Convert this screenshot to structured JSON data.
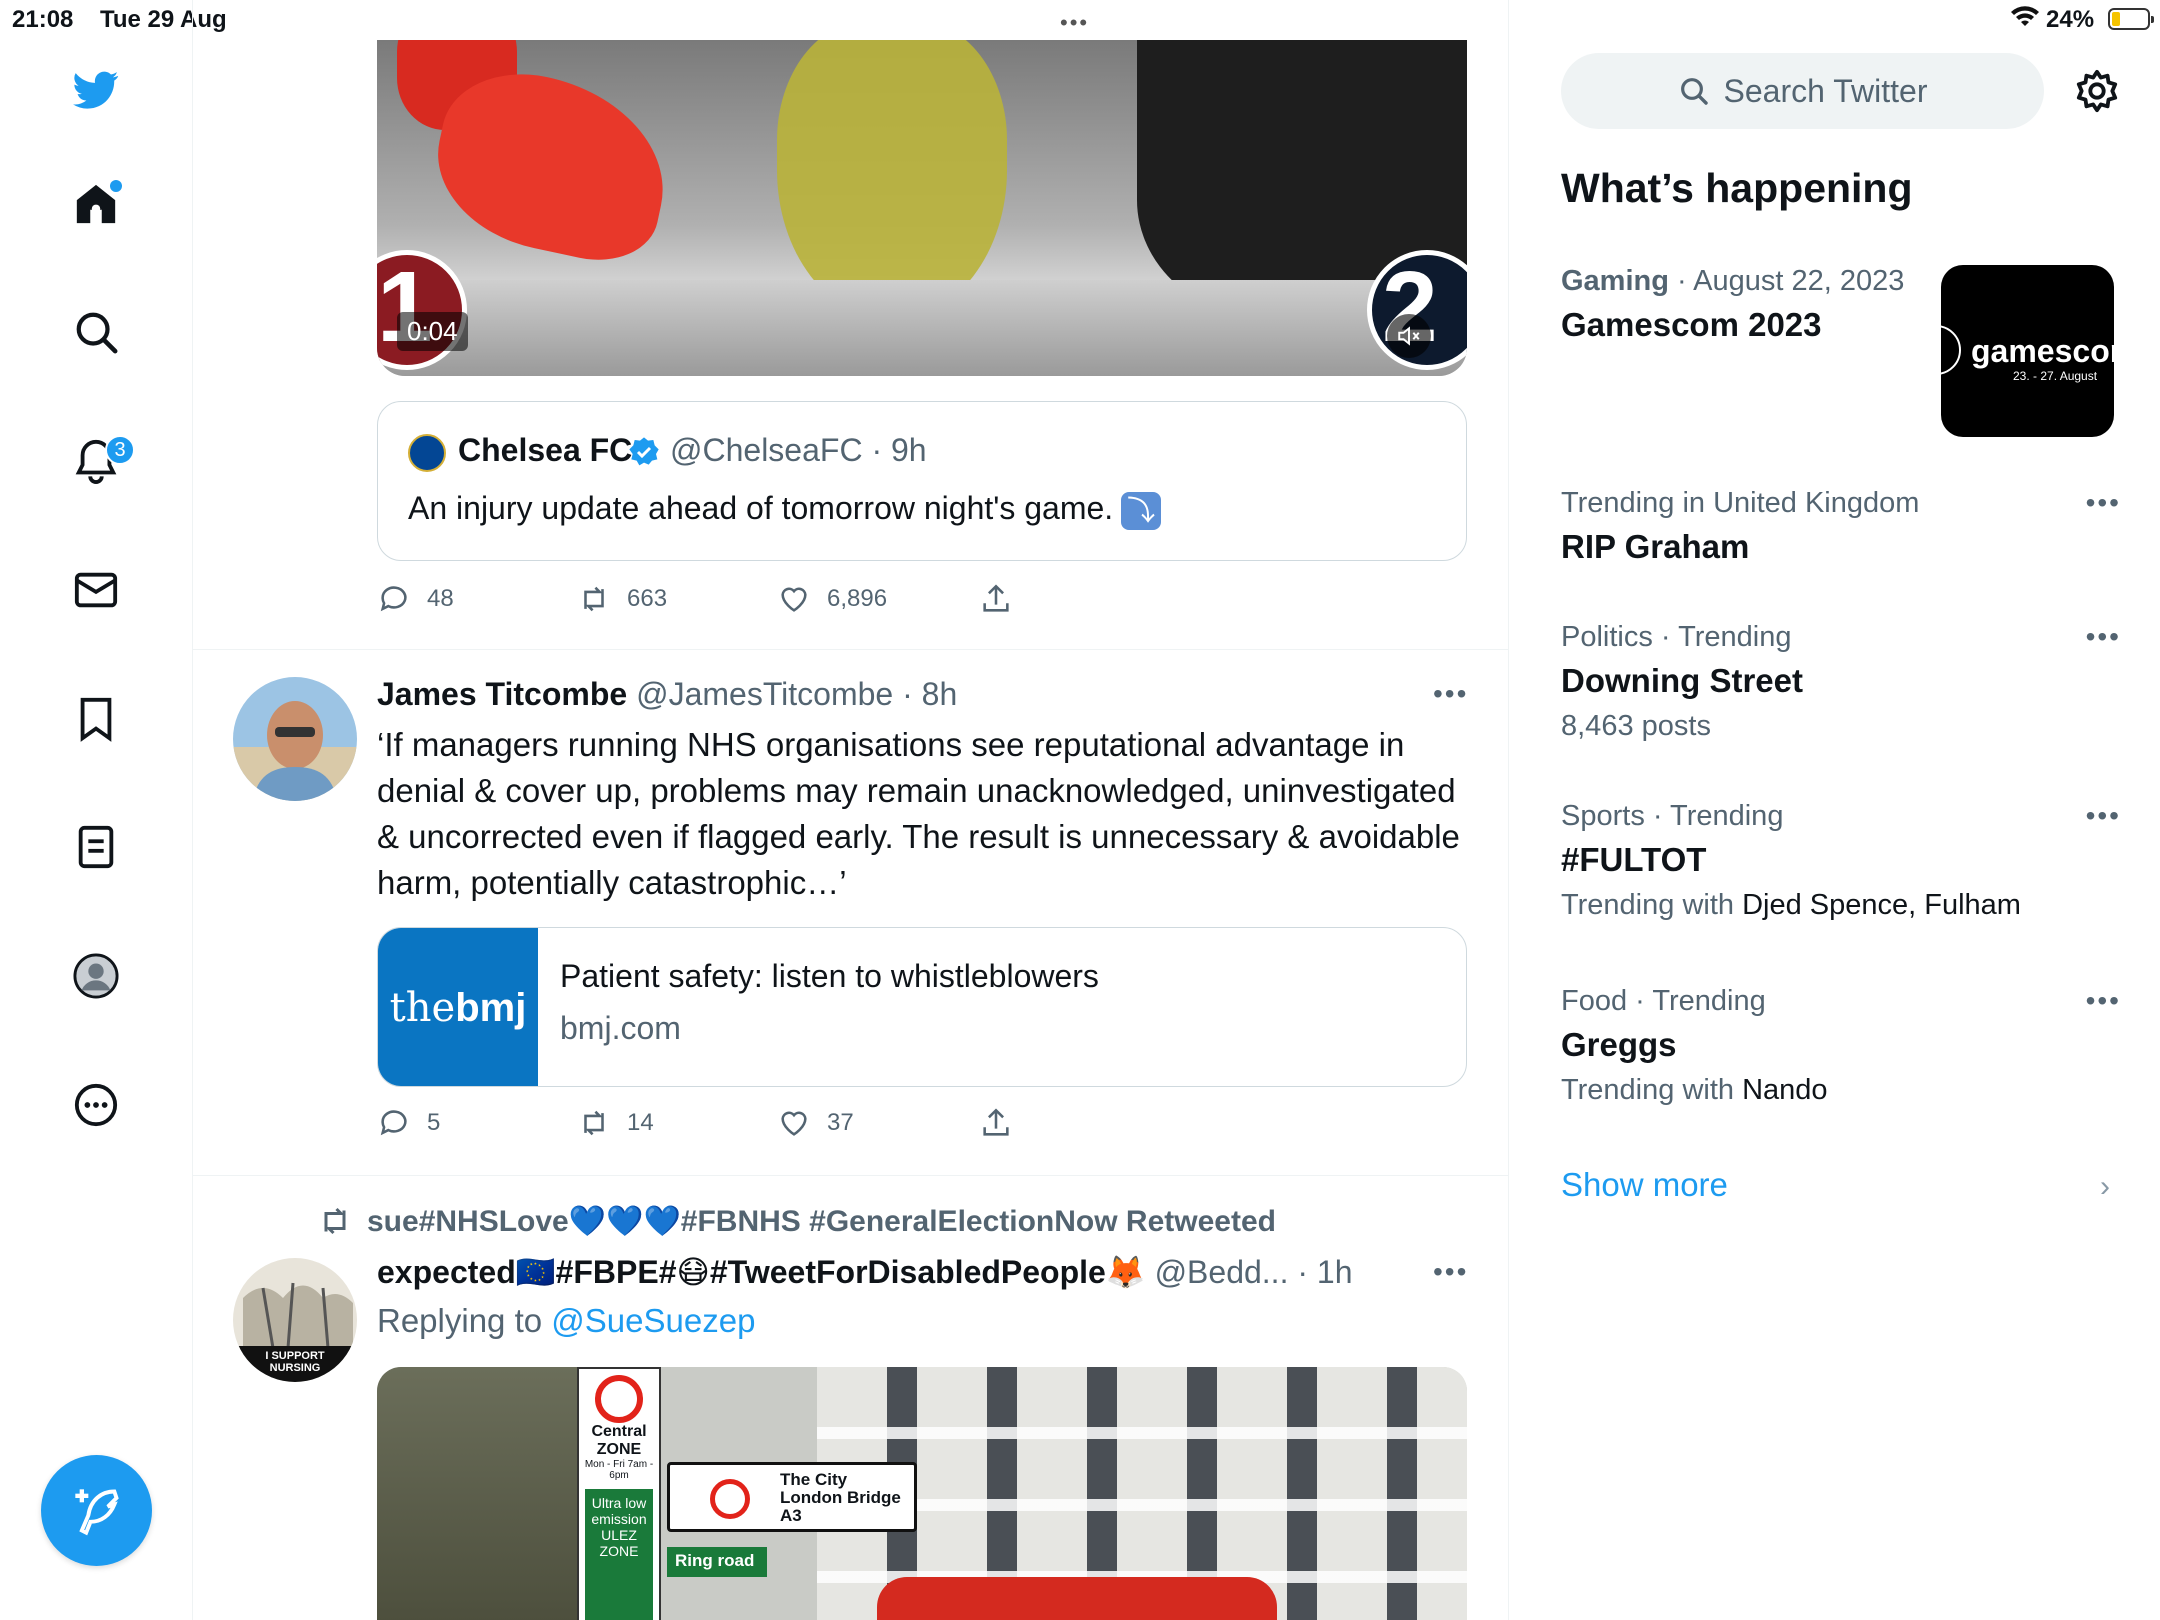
{
  "status_bar": {
    "time": "21:08",
    "date": "Tue 29 Aug",
    "battery": "24%",
    "battery_level": 0.24
  },
  "nav": {
    "items": [
      {
        "name": "home",
        "has_dot": true
      },
      {
        "name": "explore"
      },
      {
        "name": "notifications",
        "badge": "3"
      },
      {
        "name": "messages"
      },
      {
        "name": "bookmarks"
      },
      {
        "name": "lists"
      },
      {
        "name": "profile"
      },
      {
        "name": "more"
      }
    ],
    "accent": "#1d9bf0"
  },
  "tweet1": {
    "video_duration": "0:04",
    "score_left": "1",
    "score_right": "2",
    "quote": {
      "name": "Chelsea FC",
      "handle_time": "@ChelseaFC · 9h",
      "text": "An injury update ahead of tomorrow night's game.",
      "emoji": "⤵"
    },
    "actions": {
      "replies": "48",
      "retweets": "663",
      "likes": "6,896"
    }
  },
  "tweet2": {
    "name": "James Titcombe",
    "handle_time": "@JamesTitcombe · 8h",
    "text": "‘If managers running NHS organisations see reputational advantage in denial & cover up, problems may remain unacknowledged, uninvestigated & uncorrected even if flagged early. The result is unnecessary & avoidable harm, potentially catastrophic…’",
    "card": {
      "thumb_light": "the",
      "thumb_bold": "bmj",
      "title": "Patient safety: listen to whistleblowers",
      "domain": "bmj.com"
    },
    "actions": {
      "replies": "5",
      "retweets": "14",
      "likes": "37"
    }
  },
  "tweet3": {
    "retweeted_by": "sue#NHSLove💙💙💙#FBNHS #GeneralElectionNow Retweeted",
    "name": "expected🇪🇺#FBPE#😷#TweetForDisabledPeople🦊",
    "handle_time": "@Bedd... · 1h",
    "replying_prefix": "Replying to",
    "replying_handle": "@SueSuezep",
    "avatar_text": "I SUPPORT NURSING",
    "signs": {
      "central": "Central ZONE",
      "hours": "Mon - Fri 7am - 6pm",
      "ulez": "Ultra low emission ULEZ ZONE",
      "direction": "The City London Bridge A3",
      "ring": "Ring road"
    }
  },
  "sidebar": {
    "search_placeholder": "Search Twitter",
    "section_title": "What’s happening",
    "trends": [
      {
        "category": "Gaming",
        "context": " · August 22, 2023",
        "title": "Gamescom 2023",
        "sub_prefix": "",
        "sub_value": "",
        "thumb_text": "gamescom",
        "thumb_dates": "23. - 27. August"
      },
      {
        "category": "Trending in United Kingdom",
        "context": "",
        "title": "RIP Graham",
        "sub_prefix": "",
        "sub_value": ""
      },
      {
        "category": "Politics · Trending",
        "context": "",
        "title": "Downing Street",
        "sub_prefix": "8,463 posts",
        "sub_value": ""
      },
      {
        "category": "Sports · Trending",
        "context": "",
        "title": "#FULTOT",
        "sub_prefix": "Trending with ",
        "sub_value": "Djed Spence, Fulham"
      },
      {
        "category": "Food · Trending",
        "context": "",
        "title": "Greggs",
        "sub_prefix": "Trending with ",
        "sub_value": "Nando"
      }
    ],
    "show_more": "Show more"
  }
}
